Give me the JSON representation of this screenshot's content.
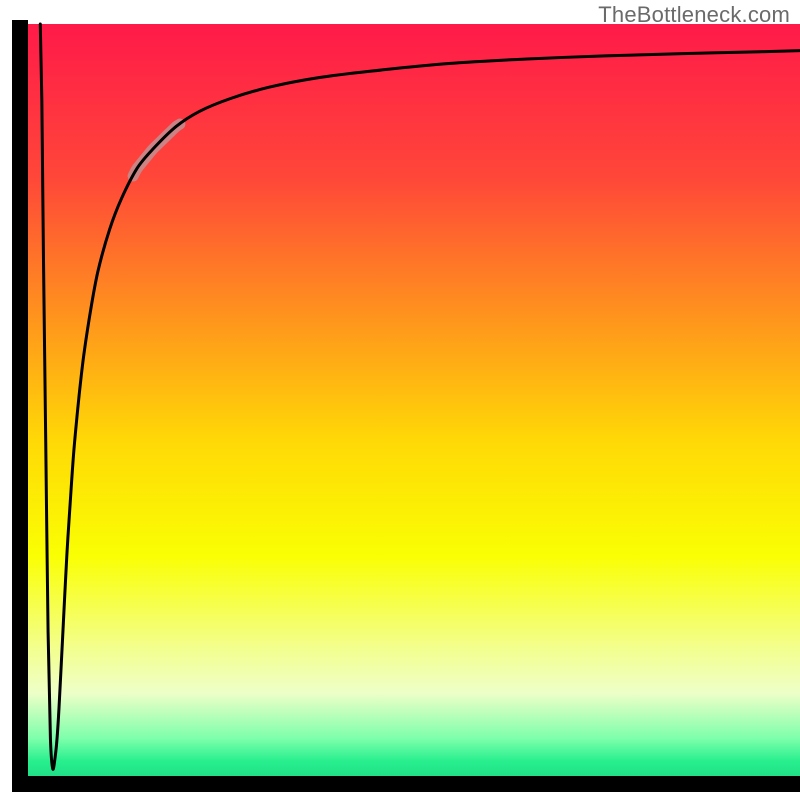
{
  "source_watermark": "TheBottleneck.com",
  "chart_data": {
    "type": "line",
    "title": "",
    "xlabel": "",
    "ylabel": "",
    "xlim": [
      0,
      100
    ],
    "ylim": [
      0,
      100
    ],
    "grid": false,
    "background_gradient": {
      "stops": [
        {
          "offset": 0.0,
          "color": "#ff1a49"
        },
        {
          "offset": 0.2,
          "color": "#ff4639"
        },
        {
          "offset": 0.4,
          "color": "#ff9a1b"
        },
        {
          "offset": 0.55,
          "color": "#ffd906"
        },
        {
          "offset": 0.7,
          "color": "#faff03"
        },
        {
          "offset": 0.82,
          "color": "#f3ff8c"
        },
        {
          "offset": 0.88,
          "color": "#eeffc8"
        },
        {
          "offset": 0.94,
          "color": "#7dffab"
        },
        {
          "offset": 0.97,
          "color": "#28ef8e"
        },
        {
          "offset": 1.0,
          "color": "#1cd884"
        }
      ]
    },
    "axis_color": "#000000",
    "curve_color": "#000000",
    "curve_stroke_width": 3,
    "highlight_segment": {
      "color": "#c58b8d",
      "stroke_width": 11,
      "x_start": 14.5,
      "x_end": 20.5
    },
    "series": [
      {
        "name": "bottleneck-curve",
        "x": [
          2.6,
          2.8,
          3.0,
          3.3,
          3.6,
          3.9,
          4.2,
          4.5,
          4.75,
          5.0,
          5.5,
          6.0,
          6.5,
          7.0,
          8.0,
          9.0,
          10.0,
          11.5,
          13.0,
          15.0,
          17.0,
          20.0,
          23.0,
          27.0,
          32.0,
          38.0,
          45.0,
          55.0,
          65.0,
          75.0,
          85.0,
          95.0,
          100.0
        ],
        "y": [
          100.0,
          90.0,
          70.0,
          45.0,
          20.0,
          6.0,
          2.0,
          3.5,
          6.0,
          10.0,
          20.0,
          30.0,
          38.0,
          45.0,
          55.0,
          62.0,
          67.5,
          73.0,
          77.0,
          81.0,
          83.5,
          86.5,
          88.5,
          90.2,
          91.7,
          92.9,
          93.8,
          94.8,
          95.4,
          95.8,
          96.1,
          96.35,
          96.5
        ]
      }
    ],
    "annotations": []
  }
}
